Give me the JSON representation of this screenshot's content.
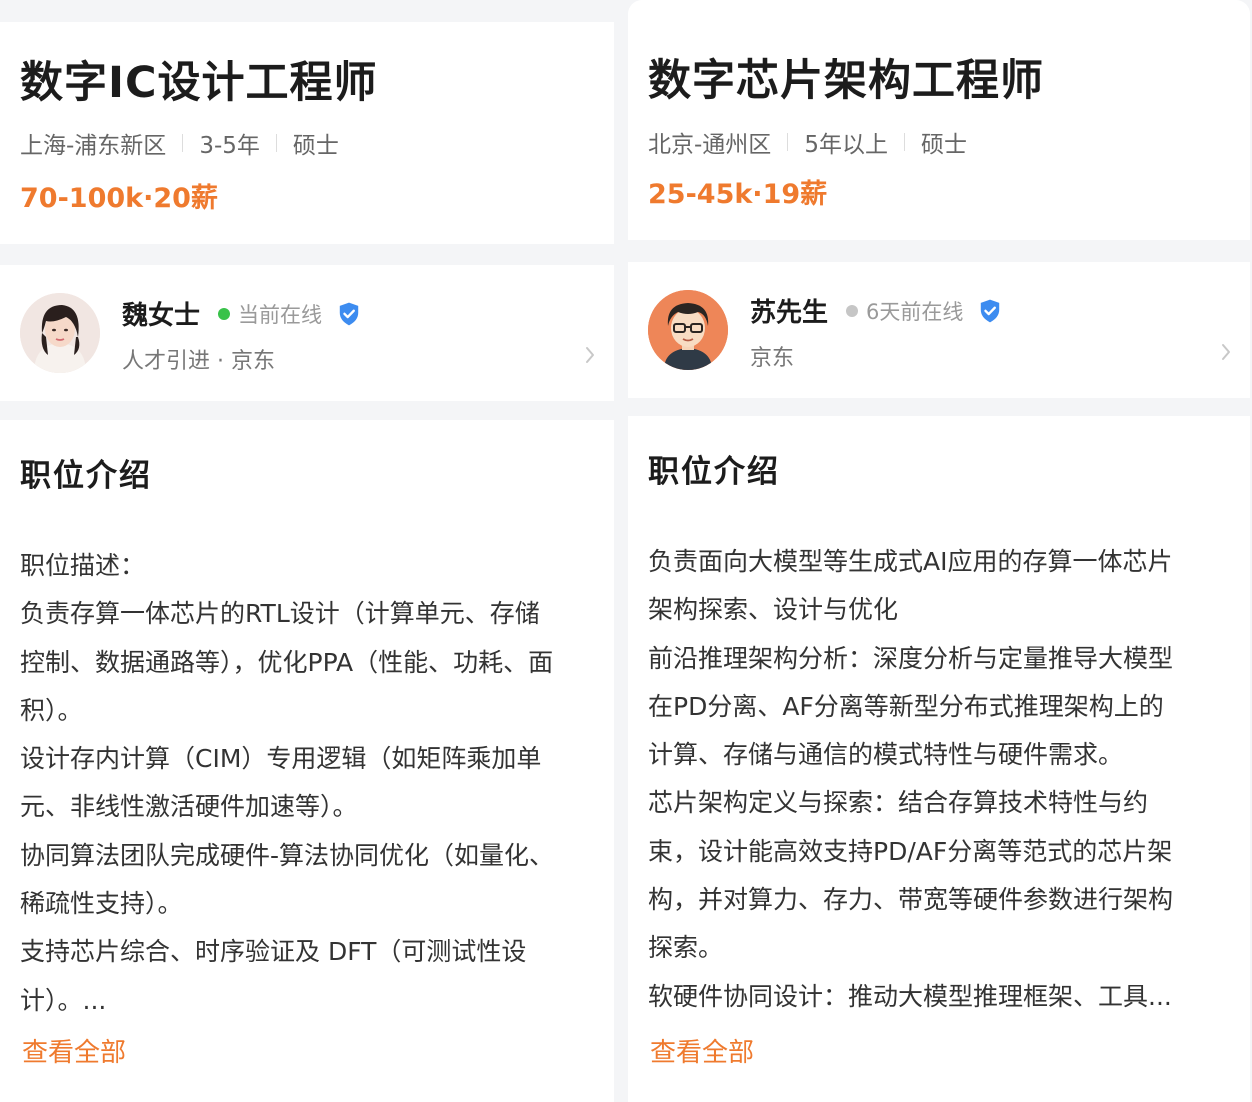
{
  "jobs": [
    {
      "title": "数字IC设计工程师",
      "location": "上海-浦东新区",
      "experience": "3-5年",
      "education": "硕士",
      "salary": "70-100k·20薪",
      "recruiter": {
        "name": "魏女士",
        "status": "当前在线",
        "status_color": "#39c24a",
        "subtitle": "人才引进 · 京东"
      },
      "section_title": "职位介绍",
      "description_lines": [
        "职位描述：",
        "负责存算一体芯片的RTL设计（计算单元、存储",
        "控制、数据通路等），优化PPA（性能、功耗、面",
        "积）。",
        "设计存内计算（CIM）专用逻辑（如矩阵乘加单",
        "元、非线性激活硬件加速等）。",
        "协同算法团队完成硬件-算法协同优化（如量化、",
        "稀疏性支持）。",
        "支持芯片综合、时序验证及 DFT（可测试性设",
        "计）。..."
      ],
      "view_all": "查看全部"
    },
    {
      "title": "数字芯片架构工程师",
      "location": "北京-通州区",
      "experience": "5年以上",
      "education": "硕士",
      "salary": "25-45k·19薪",
      "recruiter": {
        "name": "苏先生",
        "status": "6天前在线",
        "status_color": "#c6c6c6",
        "subtitle": "京东"
      },
      "section_title": "职位介绍",
      "description_lines": [
        "负责面向大模型等生成式AI应用的存算一体芯片",
        "架构探索、设计与优化",
        "前沿推理架构分析：深度分析与定量推导大模型",
        "在PD分离、AF分离等新型分布式推理架构上的",
        "计算、存储与通信的模式特性与硬件需求。",
        "芯片架构定义与探索：结合存算技术特性与约",
        "束，设计能高效支持PD/AF分离等范式的芯片架",
        "构，并对算力、存力、带宽等硬件参数进行架构",
        "探索。",
        "软硬件协同设计：推动大模型推理框架、工具..."
      ],
      "view_all": "查看全部"
    }
  ],
  "colors": {
    "accent_orange": "#ef7a2e",
    "verified_blue": "#3d8cf0",
    "background": "#f4f5f7"
  },
  "icons": {
    "verified": "verified-badge-icon",
    "chevron": "chevron-right-icon"
  }
}
